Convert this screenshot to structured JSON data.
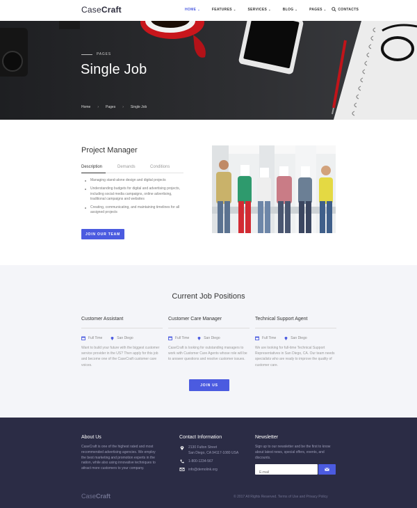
{
  "brand": {
    "logo_light": "Case",
    "logo_bold": "Craft",
    "accent": "#4b5be0",
    "footer_bg": "#2b2c45"
  },
  "nav": {
    "items": [
      {
        "label": "HOME",
        "has_dropdown": true,
        "active": true
      },
      {
        "label": "FEATURES",
        "has_dropdown": true
      },
      {
        "label": "SERVICES",
        "has_dropdown": true
      },
      {
        "label": "BLOG",
        "has_dropdown": true
      },
      {
        "label": "PAGES",
        "has_dropdown": true
      },
      {
        "label": "CONTACTS",
        "has_dropdown": false
      }
    ],
    "search_icon": "search-icon"
  },
  "hero": {
    "eyebrow": "PAGES",
    "title": "Single Job",
    "breadcrumbs": [
      "Home",
      "Pages",
      "Single Job"
    ]
  },
  "job": {
    "title": "Project Manager",
    "tabs": [
      "Description",
      "Demands",
      "Conditions"
    ],
    "active_tab": "Description",
    "description": [
      "Managing stand-alone design and digital projects",
      "Understanding budgets for digital and advertising projects, including social media campaigns, online advertising, traditional campaigns and websites",
      "Creating, communicating, and maintaining timelines for all assigned projects"
    ],
    "cta": "JOIN OUR TEAM"
  },
  "positions": {
    "title": "Current Job Positions",
    "items": [
      {
        "title": "Customer Assistant",
        "type": "Full Time",
        "location": "San Diego",
        "description": "Want to build your future with the biggest customer service provider in the US? Then apply for this job and become one of the CaseCraft customer care voices."
      },
      {
        "title": "Customer Care Manager",
        "type": "Full Time",
        "location": "San Diego",
        "description": "CaseCraft is looking for outstanding managers to work with Customer Care Agents whose role will be to answer questions and resolve customer issues."
      },
      {
        "title": "Technical Support Agent",
        "type": "Full Time",
        "location": "San Diego",
        "description": "We are looking for full-time Technical Support Representatives in San Diego, CA. Our team needs specialists who are ready to improve the quality of customer care."
      }
    ],
    "cta": "JOIN US"
  },
  "footer": {
    "about": {
      "title": "About Us",
      "text": "CaseCraft is one of the highest rated and most recommended advertising agencies. We employ the best marketing and promotion experts in the nation, while also using innovative techniques to attract more customers to your company."
    },
    "contact": {
      "title": "Contact Information",
      "address_line1": "2130 Fulton Street",
      "address_line2": "San Diego, CA 94117-1080 USA",
      "phone": "1-800-1234-567",
      "email": "info@demolink.org"
    },
    "newsletter": {
      "title": "Newsletter",
      "text": "Sign up to our newsletter and be the first to know about latest news, special offers, events, and discounts.",
      "placeholder": "E-mail"
    },
    "copyright": "© 2017 All Rights Reserved. Terms of Use and Privacy Policy"
  }
}
